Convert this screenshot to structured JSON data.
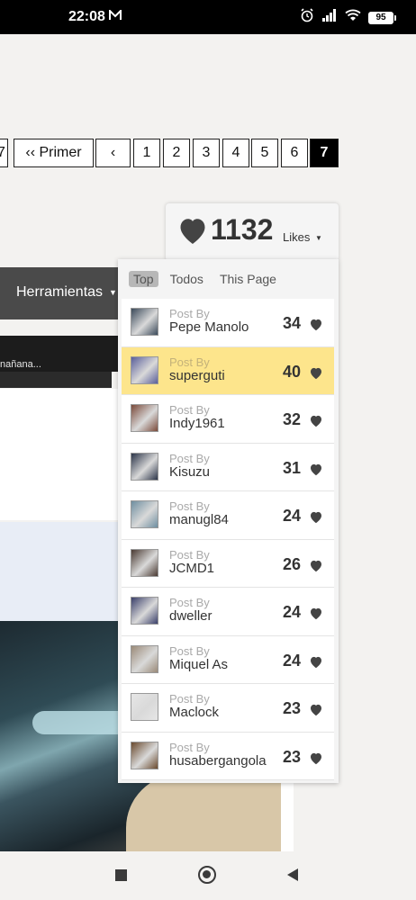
{
  "status_bar": {
    "time": "22:08",
    "mail_icon": "M",
    "battery": "95",
    "icons": [
      "alarm-icon",
      "signal-icon",
      "wifi-icon",
      "battery-icon"
    ]
  },
  "pagination": {
    "partial_left": "7",
    "first_label": "Primer",
    "first_chevrons": "‹‹",
    "prev_chevron": "‹",
    "pages": [
      "1",
      "2",
      "3",
      "4",
      "5",
      "6",
      "7"
    ],
    "active_page": "7"
  },
  "background_page": {
    "menu_label": "Herramientas",
    "search_text": "nañana..."
  },
  "likes_widget": {
    "count": "1132",
    "label": "Likes",
    "tabs": [
      "Top",
      "Todos",
      "This Page"
    ],
    "active_tab": "Top",
    "post_by_label": "Post By",
    "rows": [
      {
        "name": "Pepe Manolo",
        "count": "34",
        "highlight": false,
        "thumb_color": "#3b4a5a"
      },
      {
        "name": "superguti",
        "count": "40",
        "highlight": true,
        "thumb_color": "#5a5f9a"
      },
      {
        "name": "Indy1961",
        "count": "32",
        "highlight": false,
        "thumb_color": "#7a4a3a"
      },
      {
        "name": "Kisuzu",
        "count": "31",
        "highlight": false,
        "thumb_color": "#2b3448"
      },
      {
        "name": "manugl84",
        "count": "24",
        "highlight": false,
        "thumb_color": "#6e8ea0"
      },
      {
        "name": "JCMD1",
        "count": "26",
        "highlight": false,
        "thumb_color": "#4a3a32"
      },
      {
        "name": "dweller",
        "count": "24",
        "highlight": false,
        "thumb_color": "#3a3f6a"
      },
      {
        "name": "Miquel As",
        "count": "24",
        "highlight": false,
        "thumb_color": "#9a8a78"
      },
      {
        "name": "Maclock",
        "count": "23",
        "highlight": false,
        "thumb_color": "#e6e6e6"
      },
      {
        "name": "husabergangola",
        "count": "23",
        "highlight": false,
        "thumb_color": "#6a4a2e"
      }
    ]
  },
  "colors": {
    "highlight": "#fde58c",
    "active_page": "#000000",
    "heart": "#444444"
  }
}
